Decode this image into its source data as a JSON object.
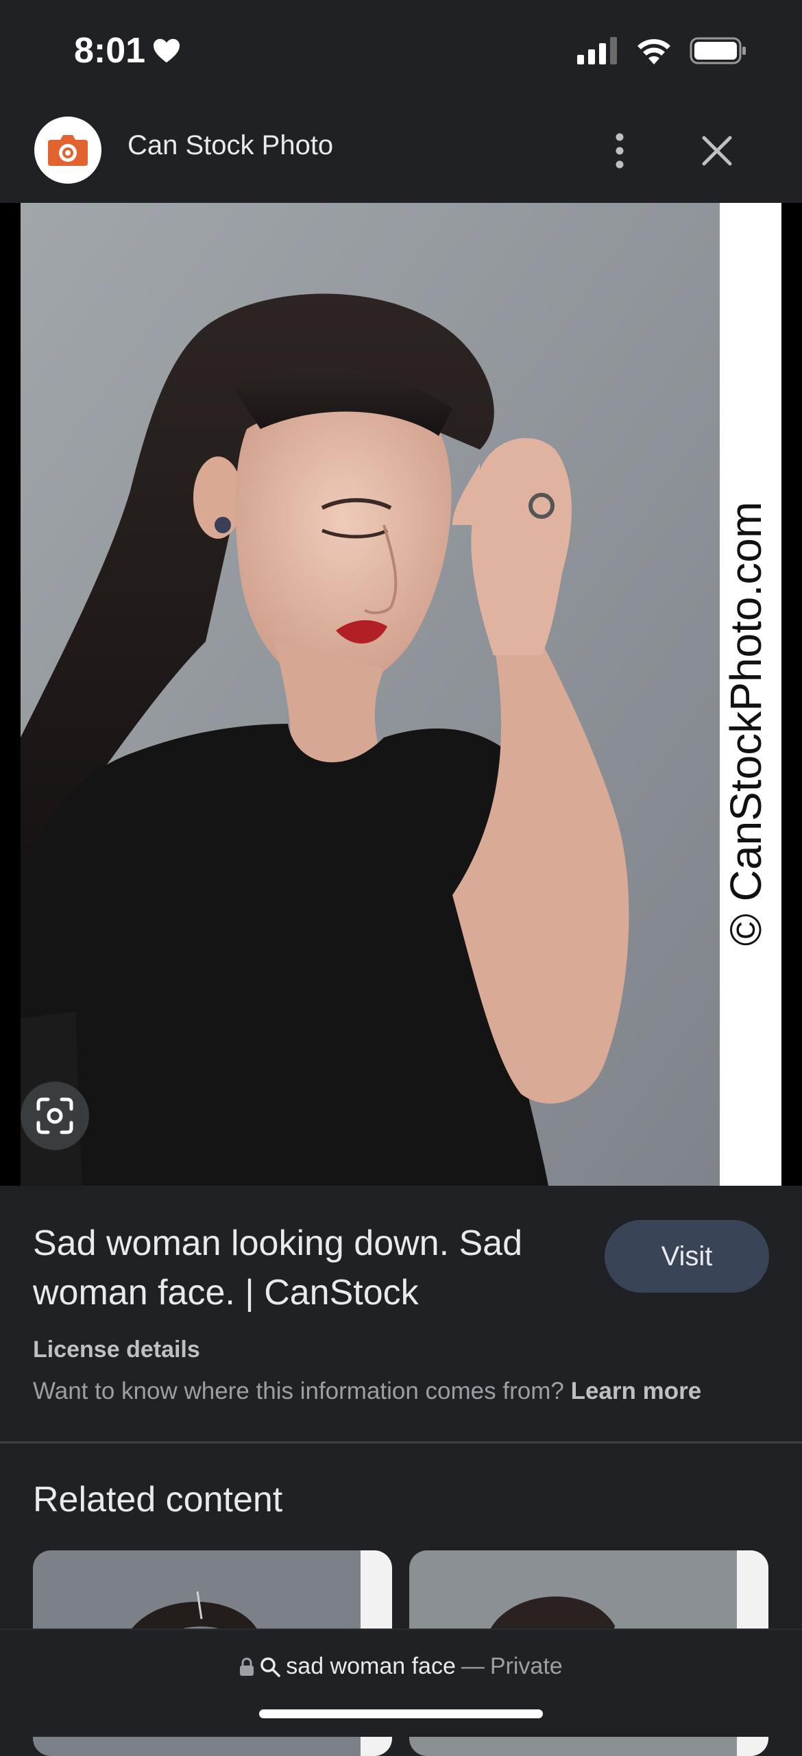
{
  "status": {
    "time": "8:01"
  },
  "header": {
    "site_name": "Can Stock Photo"
  },
  "image": {
    "watermark": "© CanStockPhoto.com"
  },
  "details": {
    "title": "Sad woman looking down. Sad woman face. | CanStock",
    "visit_label": "Visit",
    "license_label": "License details",
    "info_text": "Want to know where this information comes from?",
    "learn_more": "Learn more"
  },
  "related": {
    "title": "Related content"
  },
  "bottom": {
    "query": "sad woman face",
    "dash": "—",
    "mode": "Private"
  },
  "colors": {
    "background": "#202124",
    "visit_button": "#394457",
    "brand_orange": "#e2632f"
  }
}
